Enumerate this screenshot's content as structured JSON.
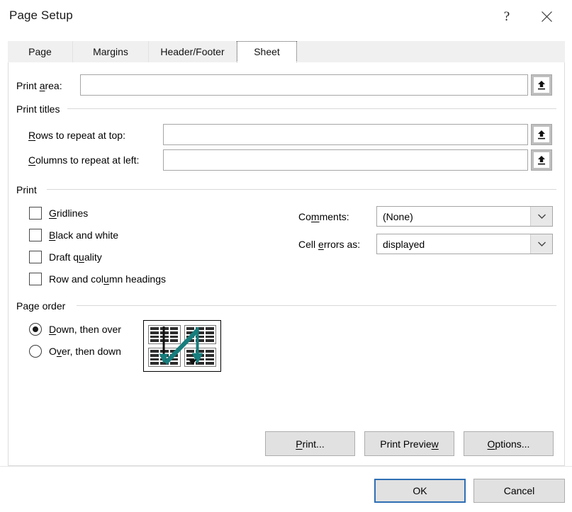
{
  "window": {
    "title": "Page Setup",
    "help_label": "?",
    "close_label": "Close",
    "help_icon": "question-mark-icon",
    "close_icon": "close-x-icon"
  },
  "tabs": [
    {
      "label": "Page",
      "selected": false
    },
    {
      "label": "Margins",
      "selected": false
    },
    {
      "label": "Header/Footer",
      "selected": false
    },
    {
      "label": "Sheet",
      "selected": true
    }
  ],
  "print_area": {
    "label_pre": "Print ",
    "label_acc": "a",
    "label_post": "rea:",
    "value": "",
    "placeholder": "",
    "picker_icon": "collapse-dialog-up-arrow-icon"
  },
  "print_titles": {
    "group_label": "Print titles",
    "rows": {
      "label_acc": "R",
      "label_post": "ows to repeat at top:",
      "value": "",
      "placeholder": "",
      "picker_icon": "collapse-dialog-up-arrow-icon"
    },
    "columns": {
      "label_acc": "C",
      "label_post": "olumns to repeat at left:",
      "value": "",
      "placeholder": "",
      "picker_icon": "collapse-dialog-up-arrow-icon"
    }
  },
  "print": {
    "group_label": "Print",
    "checkboxes": [
      {
        "pre": "",
        "acc": "G",
        "post": "ridlines",
        "checked": false
      },
      {
        "pre": "",
        "acc": "B",
        "post": "lack and white",
        "checked": false
      },
      {
        "pre": "Draft q",
        "acc": "u",
        "post": "ality",
        "checked": false
      },
      {
        "pre": "Row and col",
        "acc": "u",
        "post": "mn headings",
        "checked": false
      }
    ],
    "comments": {
      "label_pre": "Co",
      "label_acc": "m",
      "label_post": "ments:",
      "value": "(None)",
      "arrow_icon": "chevron-down-icon"
    },
    "cell_errors": {
      "label_pre": "Cell ",
      "label_acc": "e",
      "label_post": "rrors as:",
      "value": "displayed",
      "arrow_icon": "chevron-down-icon"
    }
  },
  "page_order": {
    "group_label": "Page order",
    "options": [
      {
        "pre": "",
        "acc": "D",
        "post": "own, then over",
        "selected": true
      },
      {
        "pre": "O",
        "acc": "v",
        "post": "er, then down",
        "selected": false
      }
    ],
    "preview_icon": "page-order-down-then-over-preview",
    "arrow_color": "#177d7d"
  },
  "action_buttons": [
    {
      "pre": "",
      "acc": "P",
      "post": "rint...",
      "name": "print-button"
    },
    {
      "pre": "Print Previe",
      "acc": "w",
      "post": "",
      "name": "print-preview-button"
    },
    {
      "pre": "",
      "acc": "O",
      "post": "ptions...",
      "name": "options-button"
    }
  ],
  "dialog_buttons": {
    "ok": "OK",
    "cancel": "Cancel"
  },
  "colors": {
    "accent_blue": "#2f6fb4",
    "teal_arrow": "#177d7d",
    "dialog_bg": "#ffffff",
    "button_bg": "#e1e1e1"
  }
}
